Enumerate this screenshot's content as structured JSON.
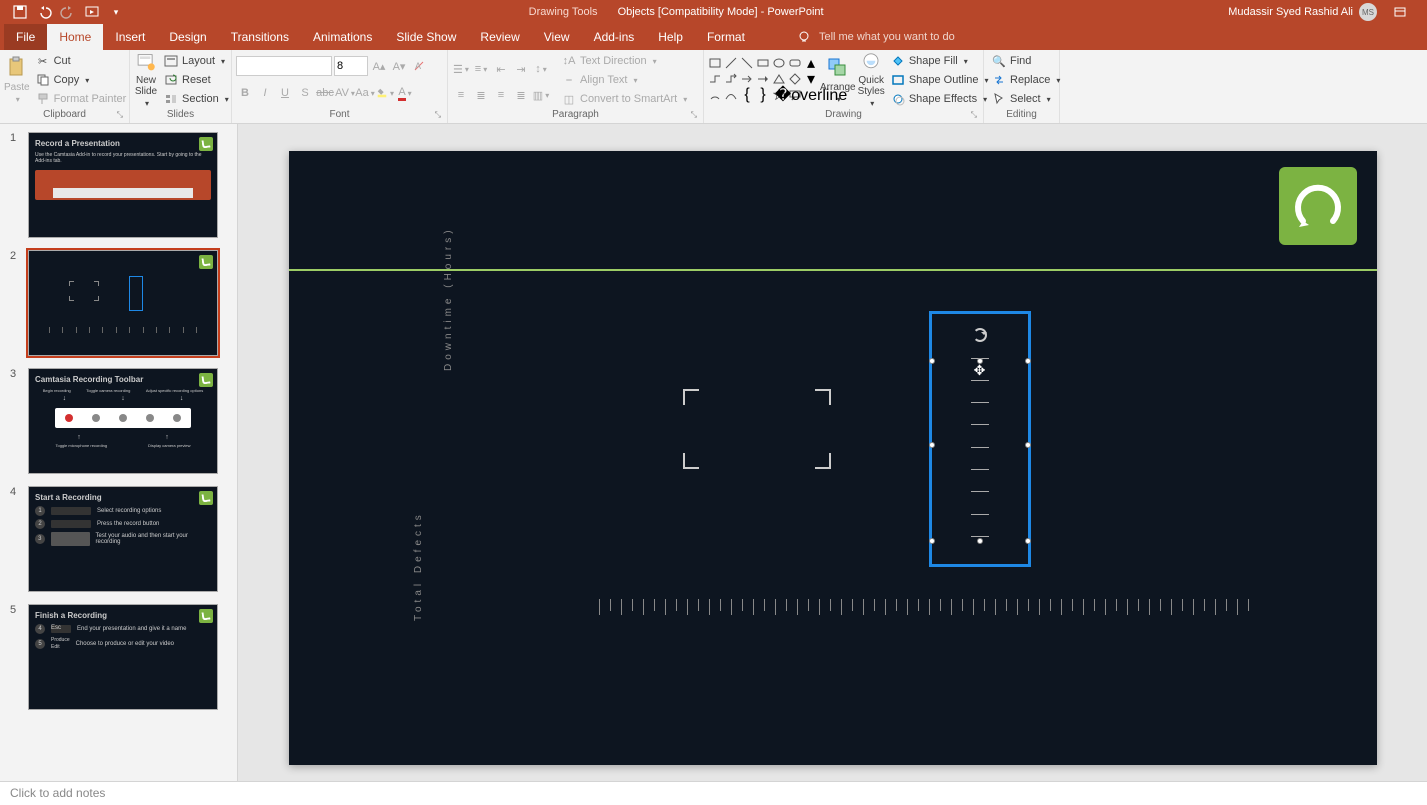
{
  "titlebar": {
    "drawing_tools": "Drawing Tools",
    "doc_title": "Objects [Compatibility Mode]  -  PowerPoint",
    "user_name": "Mudassir Syed Rashid Ali",
    "user_initials": "MS"
  },
  "tabs": {
    "file": "File",
    "home": "Home",
    "insert": "Insert",
    "design": "Design",
    "transitions": "Transitions",
    "animations": "Animations",
    "slideshow": "Slide Show",
    "review": "Review",
    "view": "View",
    "addins": "Add-ins",
    "help": "Help",
    "format": "Format",
    "tellme": "Tell me what you want to do"
  },
  "ribbon": {
    "clipboard": {
      "label": "Clipboard",
      "paste": "Paste",
      "cut": "Cut",
      "copy": "Copy",
      "format_painter": "Format Painter"
    },
    "slides": {
      "label": "Slides",
      "new_slide": "New\nSlide",
      "layout": "Layout",
      "reset": "Reset",
      "section": "Section"
    },
    "font": {
      "label": "Font",
      "font_name": "",
      "font_size": "8"
    },
    "paragraph": {
      "label": "Paragraph",
      "text_direction": "Text Direction",
      "align_text": "Align Text",
      "convert_smartart": "Convert to SmartArt"
    },
    "drawing": {
      "label": "Drawing",
      "arrange": "Arrange",
      "quick_styles": "Quick\nStyles",
      "shape_fill": "Shape Fill",
      "shape_outline": "Shape Outline",
      "shape_effects": "Shape Effects"
    },
    "editing": {
      "label": "Editing",
      "find": "Find",
      "replace": "Replace",
      "select": "Select"
    }
  },
  "thumbs": [
    {
      "num": "1",
      "title": "Record a Presentation",
      "subtitle": "Use the Camtasia Add-in to record your presentations. Start by going to the Add-ins tab."
    },
    {
      "num": "2",
      "title": ""
    },
    {
      "num": "3",
      "title": "Camtasia Recording Toolbar",
      "labels": [
        "Begin recording",
        "Toggle camera recording",
        "Adjust specific recording options",
        "Toggle microphone recording",
        "Display camera preview"
      ]
    },
    {
      "num": "4",
      "title": "Start a Recording",
      "steps": [
        "Select recording options",
        "Press the record button",
        "Test your audio and then start your recording"
      ]
    },
    {
      "num": "5",
      "title": "Finish a Recording",
      "steps": [
        "End your presentation and give it a name",
        "Choose to produce or edit your video"
      ],
      "step_nums": [
        "4",
        "5"
      ],
      "keys": [
        "Esc",
        "Produce",
        "Edit"
      ]
    }
  ],
  "canvas": {
    "y_label_1": "Downtime (Hours)",
    "y_label_2": "Total Defects"
  },
  "notes": {
    "placeholder": "Click to add notes"
  },
  "chart_data": {
    "type": "line",
    "title": "",
    "x": [],
    "series": [
      {
        "name": "Downtime (Hours)",
        "values": []
      },
      {
        "name": "Total Defects",
        "values": []
      }
    ],
    "note": "Chart on slide shows empty axes/ruler with vertical labels; no numeric tick values visible."
  }
}
